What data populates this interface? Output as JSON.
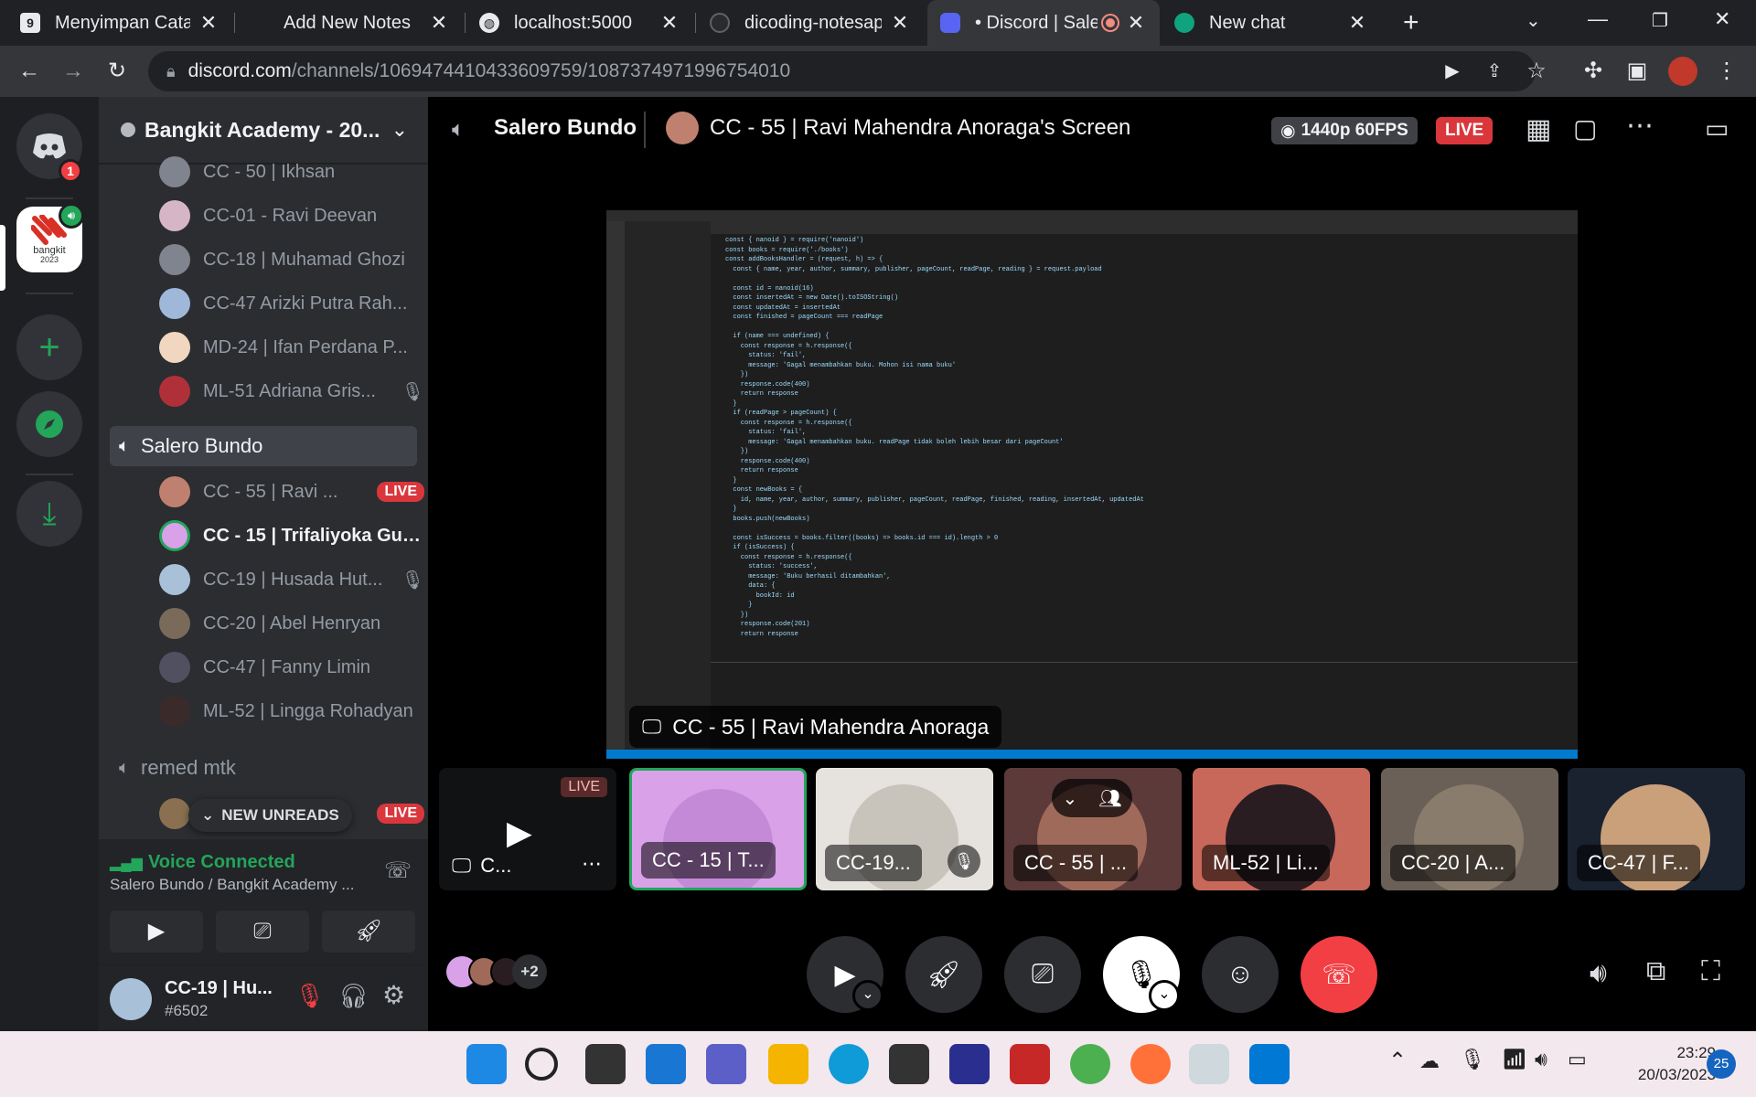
{
  "browser": {
    "tabs": [
      {
        "title": "Menyimpan Catatan",
        "favicon": "dicoding-icon",
        "active": false
      },
      {
        "title": "Add New Notes",
        "favicon": "page-icon",
        "active": false
      },
      {
        "title": "localhost:5000",
        "favicon": "globe-icon",
        "active": false
      },
      {
        "title": "dicoding-notesapp",
        "favicon": "github-icon",
        "active": false
      },
      {
        "title": "• Discord | Sale",
        "favicon": "discord-icon",
        "active": true
      },
      {
        "title": "New chat",
        "favicon": "chatgpt-icon",
        "active": false
      }
    ],
    "url_host": "discord.com",
    "url_path": "/channels/1069474410433609759/1087374971996754010"
  },
  "guilds": {
    "home_badge": "1",
    "bangkit_label": "bangkit",
    "bangkit_year": "2023"
  },
  "server": {
    "name": "Bangkit Academy - 20..."
  },
  "channels": {
    "members_top": [
      "CC - 50 | Ikhsan",
      "CC-01 - Ravi Deevan",
      "CC-18 | Muhamad Ghozi",
      "CC-47 Arizki Putra Rah...",
      "MD-24 | Ifan Perdana P...",
      "ML-51 Adriana Gris..."
    ],
    "voice_channel": "Salero Bundo",
    "voice_members": [
      "CC - 55 | Ravi ...",
      "CC - 15 | Trifaliyoka Gus...",
      "CC-19 | Husada Hut...",
      "CC-20 | Abel Henryan",
      "CC-47 | Fanny Limin",
      "ML-52 | Lingga Rohadyan"
    ],
    "live_label": "LIVE",
    "other_channel": "remed mtk",
    "new_unreads": "NEW UNREADS"
  },
  "voice_panel": {
    "status": "Voice Connected",
    "location": "Salero Bundo / Bangkit Academy ..."
  },
  "user": {
    "name": "CC-19 | Hu...",
    "tag": "#6502"
  },
  "stage": {
    "channel": "Salero Bundo",
    "stream_title": "CC - 55 | Ravi Mahendra Anoraga's Screen",
    "quality": "1440p 60FPS",
    "live": "LIVE",
    "screen_owner": "CC - 55 | Ravi Mahendra Anoraga",
    "tiles": [
      "C...",
      "CC - 15 | T...",
      "CC-19...",
      "CC - 55 | ...",
      "ML-52 | Li...",
      "CC-20 | A...",
      "CC-47 | F..."
    ],
    "extra_count": "+2"
  },
  "taskbar": {
    "time": "23:29",
    "date": "20/03/2023",
    "notif": "25"
  },
  "colors": {
    "accent": "#5865f2",
    "live": "#da373c",
    "connected": "#23a55a"
  }
}
